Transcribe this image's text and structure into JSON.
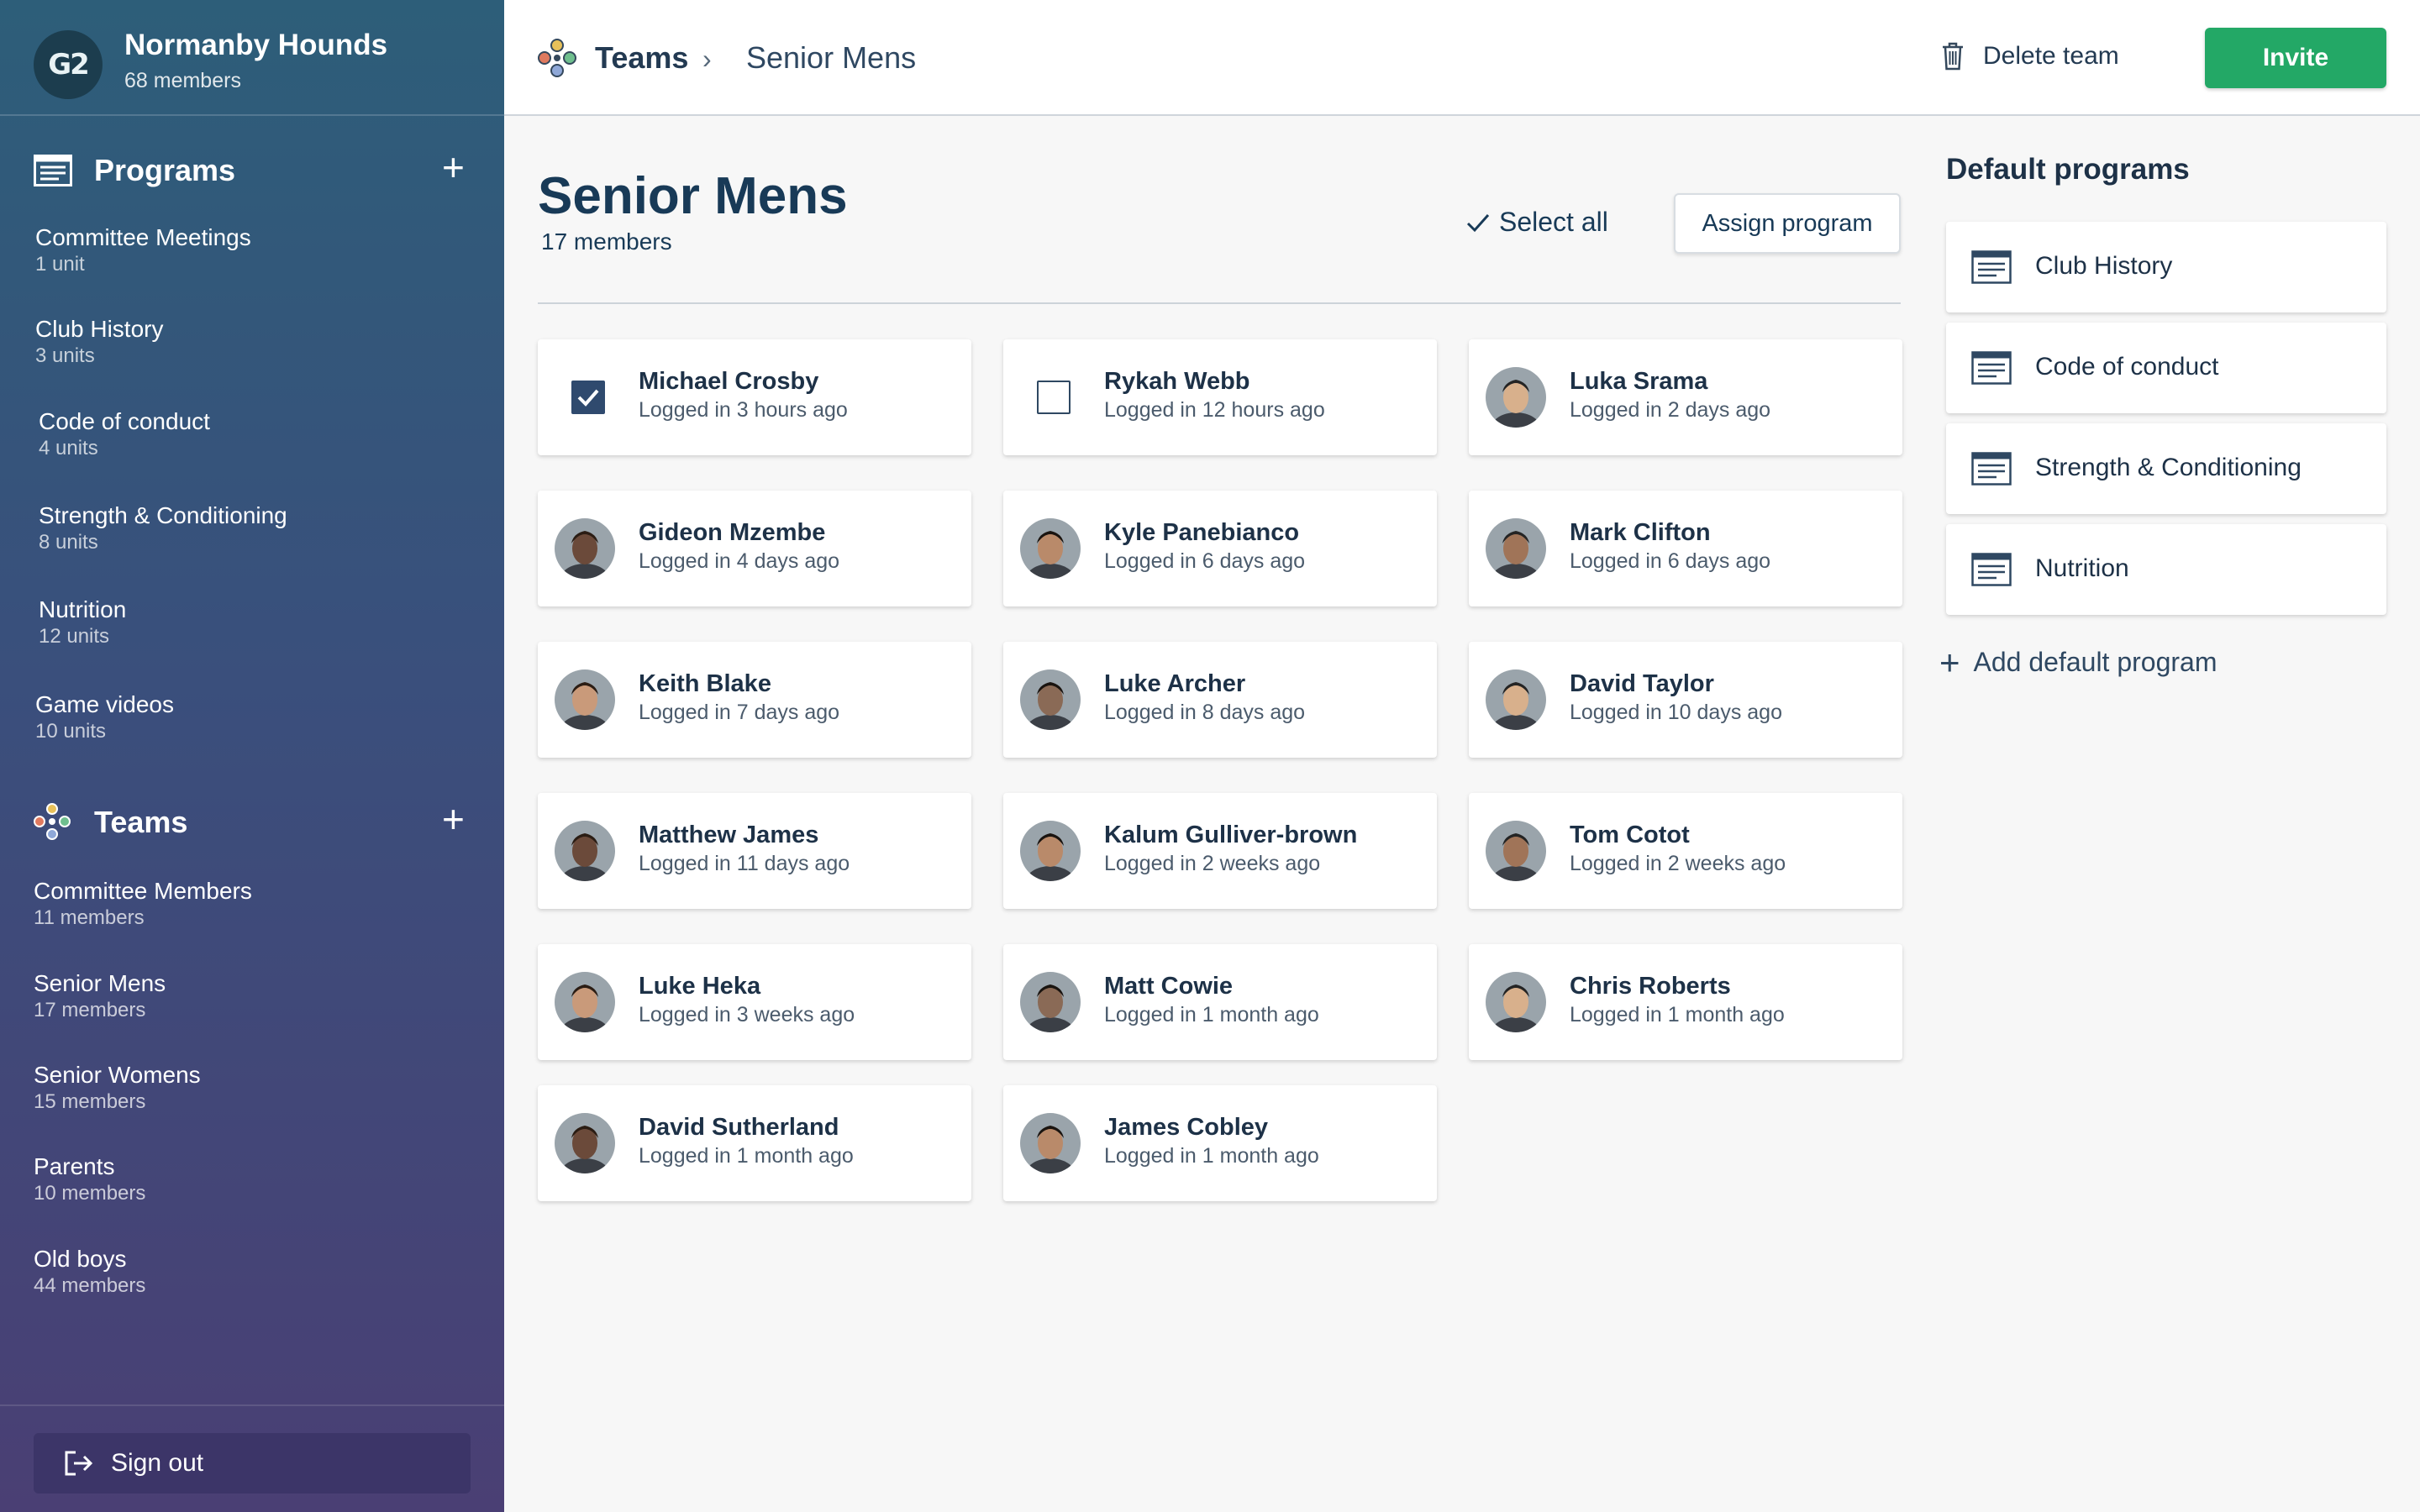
{
  "org": {
    "logo_text": "G2",
    "name": "Normanby Hounds",
    "count": "68 members"
  },
  "sidebar": {
    "programs_title": "Programs",
    "programs": [
      {
        "label": "Committee Meetings",
        "sub": "1 unit"
      },
      {
        "label": "Club History",
        "sub": "3 units"
      },
      {
        "label": "Code of conduct",
        "sub": "4 units"
      },
      {
        "label": "Strength & Conditioning",
        "sub": "8 units"
      },
      {
        "label": "Nutrition",
        "sub": "12 units"
      },
      {
        "label": "Game videos",
        "sub": "10 units"
      }
    ],
    "teams_title": "Teams",
    "teams": [
      {
        "label": "Committee Members",
        "sub": "11 members"
      },
      {
        "label": "Senior Mens",
        "sub": "17 members"
      },
      {
        "label": "Senior Womens",
        "sub": "15 members"
      },
      {
        "label": "Parents",
        "sub": "10 members"
      },
      {
        "label": "Old boys",
        "sub": "44 members"
      }
    ],
    "signout": "Sign out"
  },
  "topbar": {
    "breadcrumb_root": "Teams",
    "breadcrumb_sep": "›",
    "breadcrumb_current": "Senior Mens",
    "delete_label": "Delete team",
    "invite_label": "Invite"
  },
  "main": {
    "title": "Senior Mens",
    "subtitle": "17 members",
    "select_all": "Select all",
    "assign": "Assign program",
    "members": [
      {
        "name": "Michael Crosby",
        "login": "Logged in 3 hours ago",
        "selector": "checked"
      },
      {
        "name": "Rykah Webb",
        "login": "Logged in 12 hours ago",
        "selector": "unchecked"
      },
      {
        "name": "Luka Srama",
        "login": "Logged in 2 days ago",
        "selector": "avatar"
      },
      {
        "name": "Gideon Mzembe",
        "login": "Logged in 4 days ago",
        "selector": "avatar"
      },
      {
        "name": "Kyle Panebianco",
        "login": "Logged in 6 days ago",
        "selector": "avatar"
      },
      {
        "name": "Mark Clifton",
        "login": "Logged in 6 days ago",
        "selector": "avatar"
      },
      {
        "name": "Keith Blake",
        "login": "Logged in 7 days ago",
        "selector": "avatar"
      },
      {
        "name": "Luke Archer",
        "login": "Logged in 8 days ago",
        "selector": "avatar"
      },
      {
        "name": "David Taylor",
        "login": "Logged in 10 days ago",
        "selector": "avatar"
      },
      {
        "name": "Matthew James",
        "login": "Logged in 11 days ago",
        "selector": "avatar"
      },
      {
        "name": "Kalum Gulliver-brown",
        "login": "Logged in 2 weeks ago",
        "selector": "avatar"
      },
      {
        "name": "Tom Cotot",
        "login": "Logged in 2 weeks ago",
        "selector": "avatar"
      },
      {
        "name": "Luke Heka",
        "login": "Logged in 3 weeks ago",
        "selector": "avatar"
      },
      {
        "name": "Matt Cowie",
        "login": "Logged in 1 month ago",
        "selector": "avatar"
      },
      {
        "name": "Chris Roberts",
        "login": "Logged in 1 month ago",
        "selector": "avatar"
      },
      {
        "name": "David Sutherland",
        "login": "Logged in 1 month ago",
        "selector": "avatar"
      },
      {
        "name": "James Cobley",
        "login": "Logged in 1 month ago",
        "selector": "avatar"
      }
    ]
  },
  "default_programs": {
    "title": "Default programs",
    "items": [
      "Club History",
      "Code of conduct",
      "Strength & Conditioning",
      "Nutrition"
    ],
    "add_plus": "+",
    "add_label": "Add default program"
  },
  "colors": {
    "accent": "#23a866",
    "navy": "#183a57",
    "checkbox": "#2f4a6e"
  }
}
